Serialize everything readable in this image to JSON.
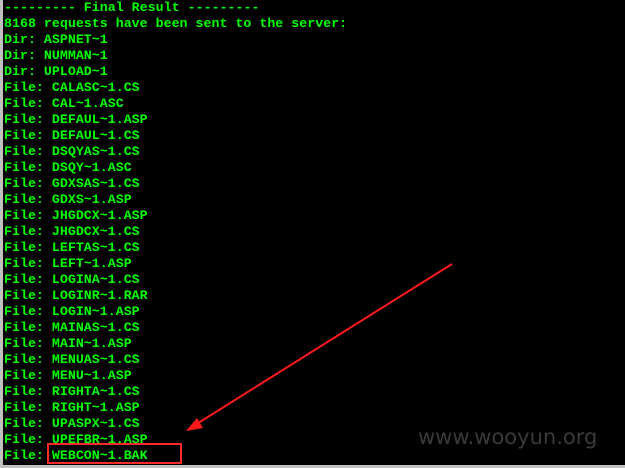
{
  "console": {
    "lines": [
      "--------- Final Result ---------",
      "8168 requests have been sent to the server:",
      "Dir: ASPNET~1",
      "Dir: NUMMAN~1",
      "Dir: UPLOAD~1",
      "File: CALASC~1.CS",
      "File: CAL~1.ASC",
      "File: DEFAUL~1.ASP",
      "File: DEFAUL~1.CS",
      "File: DSQYAS~1.CS",
      "File: DSQY~1.ASC",
      "File: GDXSAS~1.CS",
      "File: GDXS~1.ASP",
      "File: JHGDCX~1.ASP",
      "File: JHGDCX~1.CS",
      "File: LEFTAS~1.CS",
      "File: LEFT~1.ASP",
      "File: LOGINA~1.CS",
      "File: LOGINR~1.RAR",
      "File: LOGIN~1.ASP",
      "File: MAINAS~1.CS",
      "File: MAIN~1.ASP",
      "File: MENUAS~1.CS",
      "File: MENU~1.ASP",
      "File: RIGHTA~1.CS",
      "File: RIGHT~1.ASP",
      "File: UPASPX~1.CS",
      "File: UPEFBR~1.ASP",
      "File: WEBCON~1.BAK"
    ]
  },
  "watermark": "www.wooyun.org",
  "colors": {
    "text": "#00ff00",
    "annotation": "#ff2020",
    "background": "#000000"
  }
}
